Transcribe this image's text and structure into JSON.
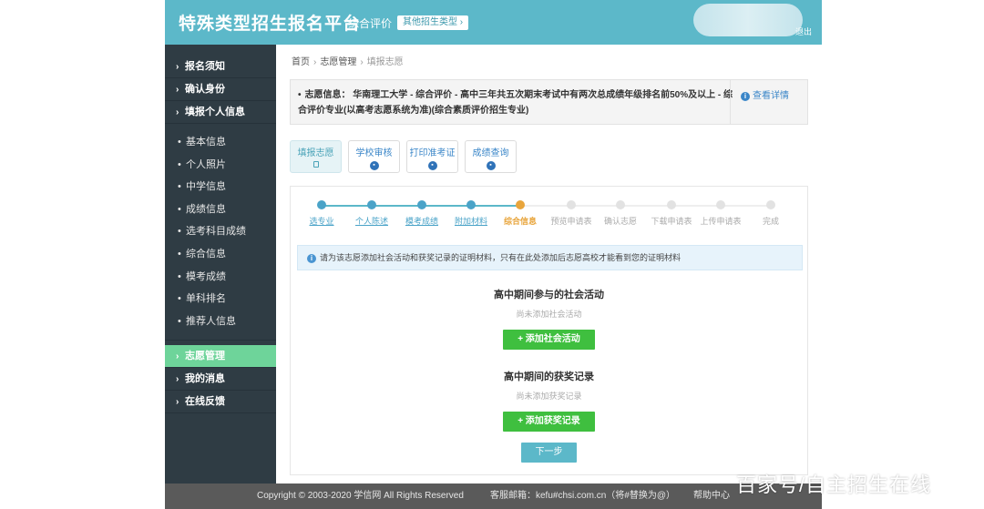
{
  "header": {
    "title": "特殊类型招生报名平台",
    "mode": "综合评价",
    "other_button": "其他招生类型",
    "exit": "退出"
  },
  "sidebar": {
    "top_items": [
      {
        "label": "报名须知"
      },
      {
        "label": "确认身份"
      },
      {
        "label": "填报个人信息"
      }
    ],
    "sub_items": [
      {
        "label": "基本信息"
      },
      {
        "label": "个人照片"
      },
      {
        "label": "中学信息"
      },
      {
        "label": "成绩信息"
      },
      {
        "label": "选考科目成绩"
      },
      {
        "label": "综合信息"
      },
      {
        "label": "模考成绩"
      },
      {
        "label": "单科排名"
      },
      {
        "label": "推荐人信息"
      }
    ],
    "bottom_items": [
      {
        "label": "志愿管理",
        "active": true
      },
      {
        "label": "我的消息"
      },
      {
        "label": "在线反馈"
      }
    ]
  },
  "breadcrumb": {
    "home": "首页",
    "section": "志愿管理",
    "current": "填报志愿",
    "separator": "›"
  },
  "info_box": {
    "text": "志愿信息： 华南理工大学 - 综合评价 - 高中三年共五次期末考试中有两次总成绩年级排名前50%及以上 - 综合评价专业(以高考志愿系统为准)(综合素质评价招生专业)",
    "detail_link": "查看详情"
  },
  "tabs": [
    {
      "label": "填报志愿",
      "active": true
    },
    {
      "label": "学校审核"
    },
    {
      "label": "打印准考证"
    },
    {
      "label": "成绩查询"
    }
  ],
  "steps": [
    {
      "label": "选专业",
      "state": "done"
    },
    {
      "label": "个人陈述",
      "state": "done"
    },
    {
      "label": "模考成绩",
      "state": "done"
    },
    {
      "label": "附加材料",
      "state": "done"
    },
    {
      "label": "综合信息",
      "state": "current"
    },
    {
      "label": "预览申请表",
      "state": "todo"
    },
    {
      "label": "确认志愿",
      "state": "todo"
    },
    {
      "label": "下载申请表",
      "state": "todo"
    },
    {
      "label": "上传申请表",
      "state": "todo"
    },
    {
      "label": "完成",
      "state": "todo"
    }
  ],
  "tip": "请为该志愿添加社会活动和获奖记录的证明材料，只有在此处添加后志愿高校才能看到您的证明材料",
  "social": {
    "title": "高中期间参与的社会活动",
    "empty": "尚未添加社会活动",
    "button": "+ 添加社会活动"
  },
  "awards": {
    "title": "高中期间的获奖记录",
    "empty": "尚未添加获奖记录",
    "button": "+ 添加获奖记录"
  },
  "next_button": "下一步",
  "footer": {
    "copyright": "Copyright © 2003-2020 学信网 All Rights Reserved",
    "mail": "客服邮箱：kefu#chsi.com.cn（将#替换为@）",
    "help": "帮助中心"
  },
  "watermark": "百家号/自主招生在线",
  "colors": {
    "header": "#5cb8c9",
    "sidebar": "#2f3c44",
    "sidebar_active": "#6ed49a",
    "step_done": "#4aa3c8",
    "step_current": "#e8a53c",
    "add_button": "#3fbf3f"
  }
}
